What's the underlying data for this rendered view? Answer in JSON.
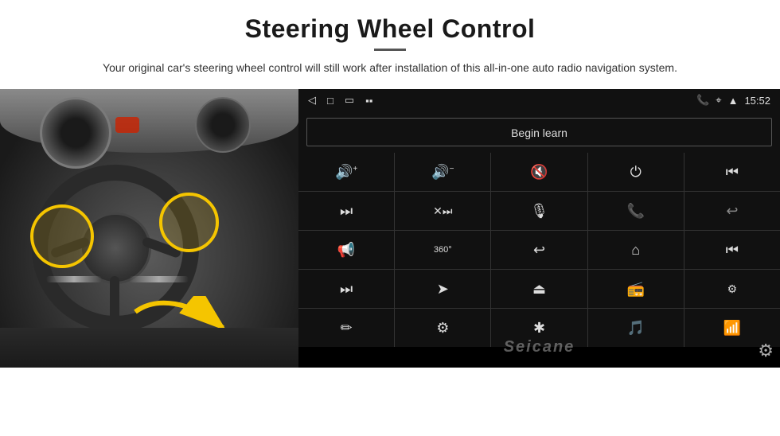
{
  "header": {
    "title": "Steering Wheel Control",
    "subtitle": "Your original car's steering wheel control will still work after installation of this all-in-one auto radio navigation system."
  },
  "android": {
    "status_bar": {
      "back_icon": "◁",
      "home_icon": "□",
      "recent_icon": "▭",
      "sim_icon": "▪▪",
      "phone_icon": "📞",
      "location_icon": "⌖",
      "wifi_icon": "▲",
      "time": "15:52"
    },
    "begin_learn_label": "Begin learn",
    "seicane_label": "Seicane",
    "controls": [
      {
        "icon": "🔊+",
        "name": "vol-up"
      },
      {
        "icon": "🔊−",
        "name": "vol-down"
      },
      {
        "icon": "🔇",
        "name": "mute"
      },
      {
        "icon": "⏻",
        "name": "power"
      },
      {
        "icon": "⏮",
        "name": "prev-track-end"
      },
      {
        "icon": "⏭",
        "name": "next"
      },
      {
        "icon": "⏩",
        "name": "fast-forward"
      },
      {
        "icon": "🎙",
        "name": "mic"
      },
      {
        "icon": "📞",
        "name": "call"
      },
      {
        "icon": "↩",
        "name": "hang-up"
      },
      {
        "icon": "📢",
        "name": "horn"
      },
      {
        "icon": "360°",
        "name": "camera360"
      },
      {
        "icon": "↩",
        "name": "back"
      },
      {
        "icon": "⌂",
        "name": "home"
      },
      {
        "icon": "⏮⏮",
        "name": "prev-prev"
      },
      {
        "icon": "⏭",
        "name": "skip"
      },
      {
        "icon": "➤",
        "name": "nav"
      },
      {
        "icon": "⏏",
        "name": "eject"
      },
      {
        "icon": "📻",
        "name": "radio"
      },
      {
        "icon": "⚙",
        "name": "eq"
      },
      {
        "icon": "✏",
        "name": "edit"
      },
      {
        "icon": "⚙",
        "name": "settings-round"
      },
      {
        "icon": "✱",
        "name": "bluetooth"
      },
      {
        "icon": "🎵",
        "name": "music"
      },
      {
        "icon": "📶",
        "name": "signal"
      }
    ]
  }
}
